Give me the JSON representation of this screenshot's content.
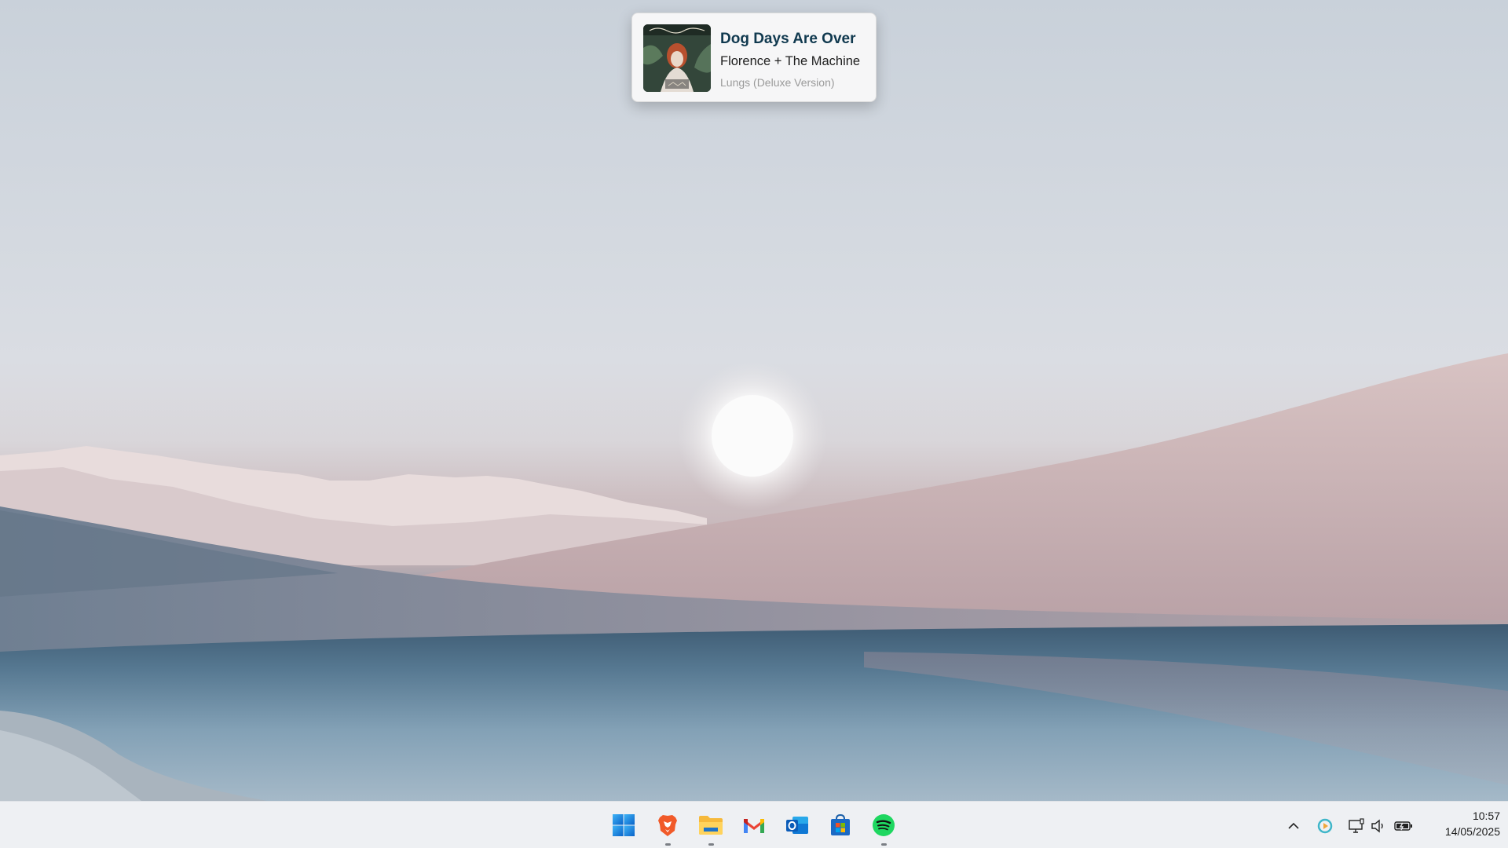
{
  "now_playing": {
    "title": "Dog Days Are Over",
    "artist": "Florence + The Machine",
    "album": "Lungs (Deluxe Version)"
  },
  "taskbar": {
    "apps": [
      {
        "name": "Start",
        "icon": "windows-start-icon",
        "running": false
      },
      {
        "name": "Brave",
        "icon": "brave-browser-icon",
        "running": true
      },
      {
        "name": "File Explorer",
        "icon": "file-explorer-icon",
        "running": true
      },
      {
        "name": "Gmail",
        "icon": "gmail-icon",
        "running": false
      },
      {
        "name": "Outlook",
        "icon": "outlook-icon",
        "running": false
      },
      {
        "name": "Microsoft Store",
        "icon": "microsoft-store-icon",
        "running": false
      },
      {
        "name": "Spotify",
        "icon": "spotify-icon",
        "running": true
      }
    ],
    "tray_icons": [
      "chevron-up-icon",
      "copilot-icon",
      "display-network-icon",
      "volume-icon",
      "battery-icon"
    ],
    "time": "10:57",
    "date": "14/05/2025"
  },
  "colors": {
    "taskbar_bg": "#eef0f3",
    "title_color": "#10394f",
    "spotify_green": "#1ed760"
  }
}
